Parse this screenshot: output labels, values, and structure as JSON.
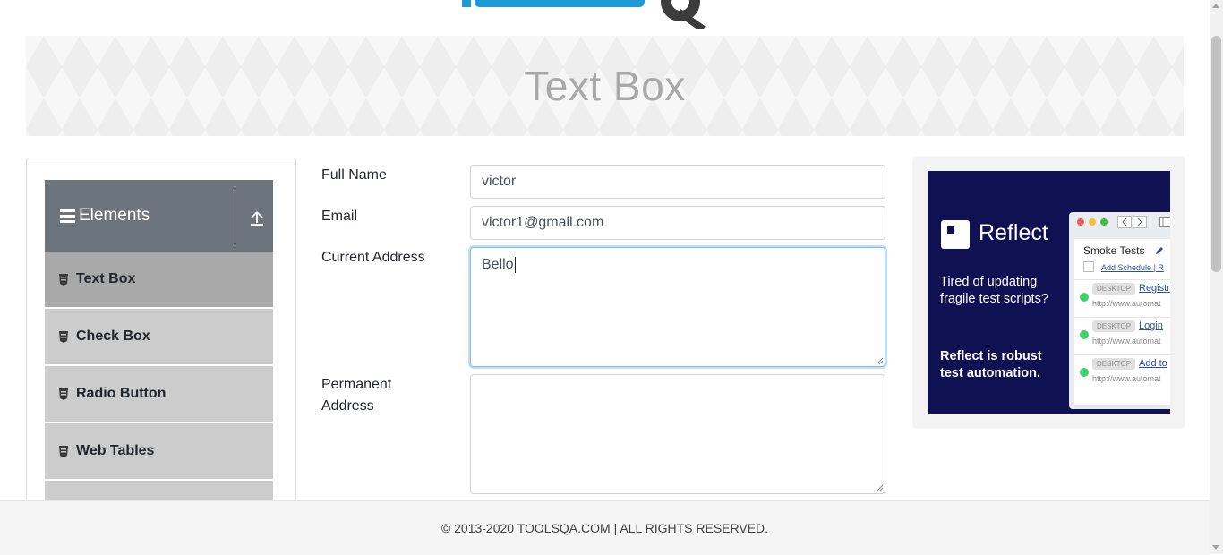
{
  "banner": {
    "title": "Text Box"
  },
  "sidebar": {
    "group_title": "Elements",
    "items": [
      {
        "label": "Text Box",
        "active": true
      },
      {
        "label": "Check Box"
      },
      {
        "label": "Radio Button"
      },
      {
        "label": "Web Tables"
      }
    ]
  },
  "form": {
    "full_name": {
      "label": "Full Name",
      "value": "victor"
    },
    "email": {
      "label": "Email",
      "value": "victor1@gmail.com"
    },
    "current_address": {
      "label": "Current Address",
      "value": "Bello"
    },
    "permanent_address": {
      "label_line1": "Permanent",
      "label_line2": "Address",
      "value": ""
    }
  },
  "ad": {
    "brand": "Reflect",
    "tagline": "Tired of updating fragile test scripts?",
    "headline": "Reflect is robust test automation.",
    "panel_title": "Smoke Tests",
    "schedule_link": "Add Schedule",
    "schedule_extra": "| R",
    "rows": [
      {
        "badge": "DESKTOP",
        "link": "Registr",
        "url": "http://www.automat"
      },
      {
        "badge": "DESKTOP",
        "link": "Login",
        "url": "http://www.automat"
      },
      {
        "badge": "DESKTOP",
        "link": "Add to",
        "url": "http://www.automat"
      }
    ]
  },
  "footer": {
    "text": "© 2013-2020 TOOLSQA.COM | ALL RIGHTS RESERVED."
  },
  "colors": {
    "sidebar_header": "#6c757d",
    "menu_item": "#cccccc",
    "menu_item_active": "#a9a9a9",
    "focus_border": "#80bdff",
    "ad_background": "#0f1153",
    "logo_blue": "#1c9bd6"
  }
}
